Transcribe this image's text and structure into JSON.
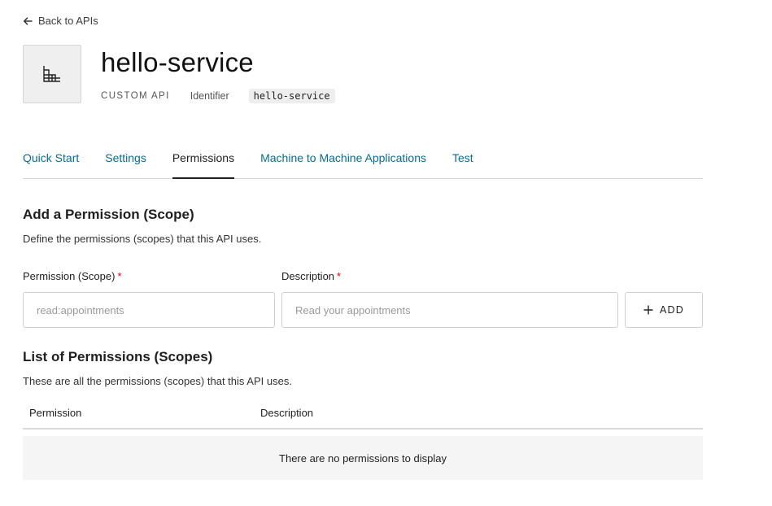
{
  "back_link": {
    "label": "Back to APIs",
    "icon": "arrow-left-icon"
  },
  "api": {
    "icon": "api-building-icon",
    "title": "hello-service",
    "type": "CUSTOM API",
    "identifier_label": "Identifier",
    "identifier_value": "hello-service"
  },
  "tabs": [
    {
      "label": "Quick Start",
      "active": false
    },
    {
      "label": "Settings",
      "active": false
    },
    {
      "label": "Permissions",
      "active": true
    },
    {
      "label": "Machine to Machine Applications",
      "active": false
    },
    {
      "label": "Test",
      "active": false
    }
  ],
  "add_section": {
    "title": "Add a Permission (Scope)",
    "description": "Define the permissions (scopes) that this API uses.",
    "permission_label": "Permission (Scope)",
    "permission_placeholder": "read:appointments",
    "description_label": "Description",
    "description_placeholder": "Read your appointments",
    "required_mark": "*",
    "add_button": {
      "label": "ADD",
      "icon": "plus-icon"
    }
  },
  "list_section": {
    "title": "List of Permissions (Scopes)",
    "description": "These are all the permissions (scopes) that this API uses.",
    "columns": [
      "Permission",
      "Description"
    ],
    "empty_message": "There are no permissions to display"
  },
  "colors": {
    "link": "#0a6b92",
    "required": "#d0021b",
    "border": "#d9d9d9",
    "empty_bg": "#f5f5f5"
  }
}
